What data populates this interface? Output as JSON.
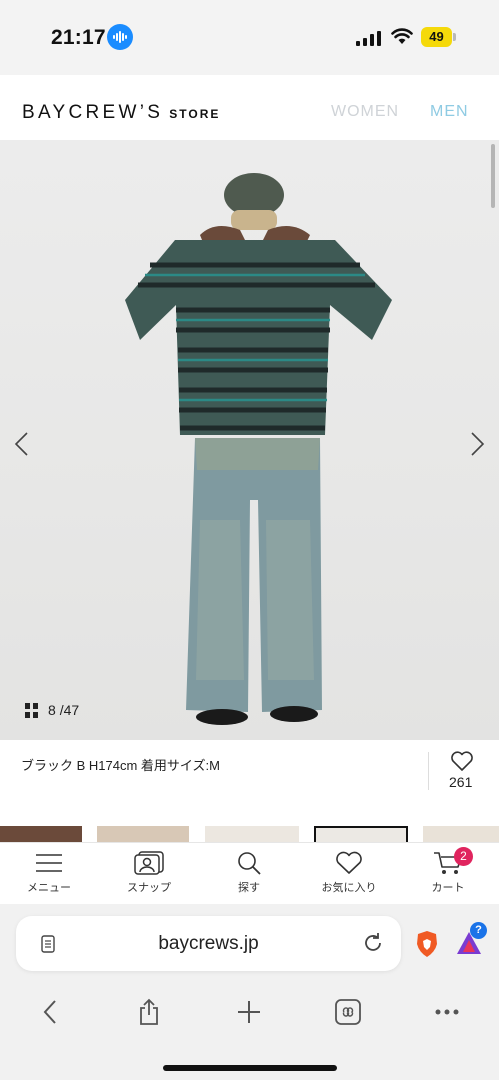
{
  "status_bar": {
    "time": "21:17",
    "battery": "49"
  },
  "header": {
    "logo_main": "BAYCREW’S",
    "logo_store": "STORE",
    "nav_women": "WOMEN",
    "nav_men": "MEN"
  },
  "gallery": {
    "counter_current": "8",
    "counter_total": "/47"
  },
  "caption": {
    "text": "ブラック B H174cm 着用サイズ:M",
    "favorite_count": "261"
  },
  "site_nav": {
    "items": [
      {
        "label": "メニュー",
        "icon": "menu-icon"
      },
      {
        "label": "スナップ",
        "icon": "snap-icon"
      },
      {
        "label": "探す",
        "icon": "search-icon"
      },
      {
        "label": "お気に入り",
        "icon": "heart-icon"
      },
      {
        "label": "カート",
        "icon": "cart-icon"
      }
    ],
    "cart_badge": "2"
  },
  "browser": {
    "url": "baycrews.jp",
    "rewards_badge": "?"
  },
  "colors": {
    "men_active": "#8fcbe3",
    "women_inactive": "#cfd3d7",
    "cart_badge": "#e0245e",
    "battery": "#f5d90a"
  }
}
